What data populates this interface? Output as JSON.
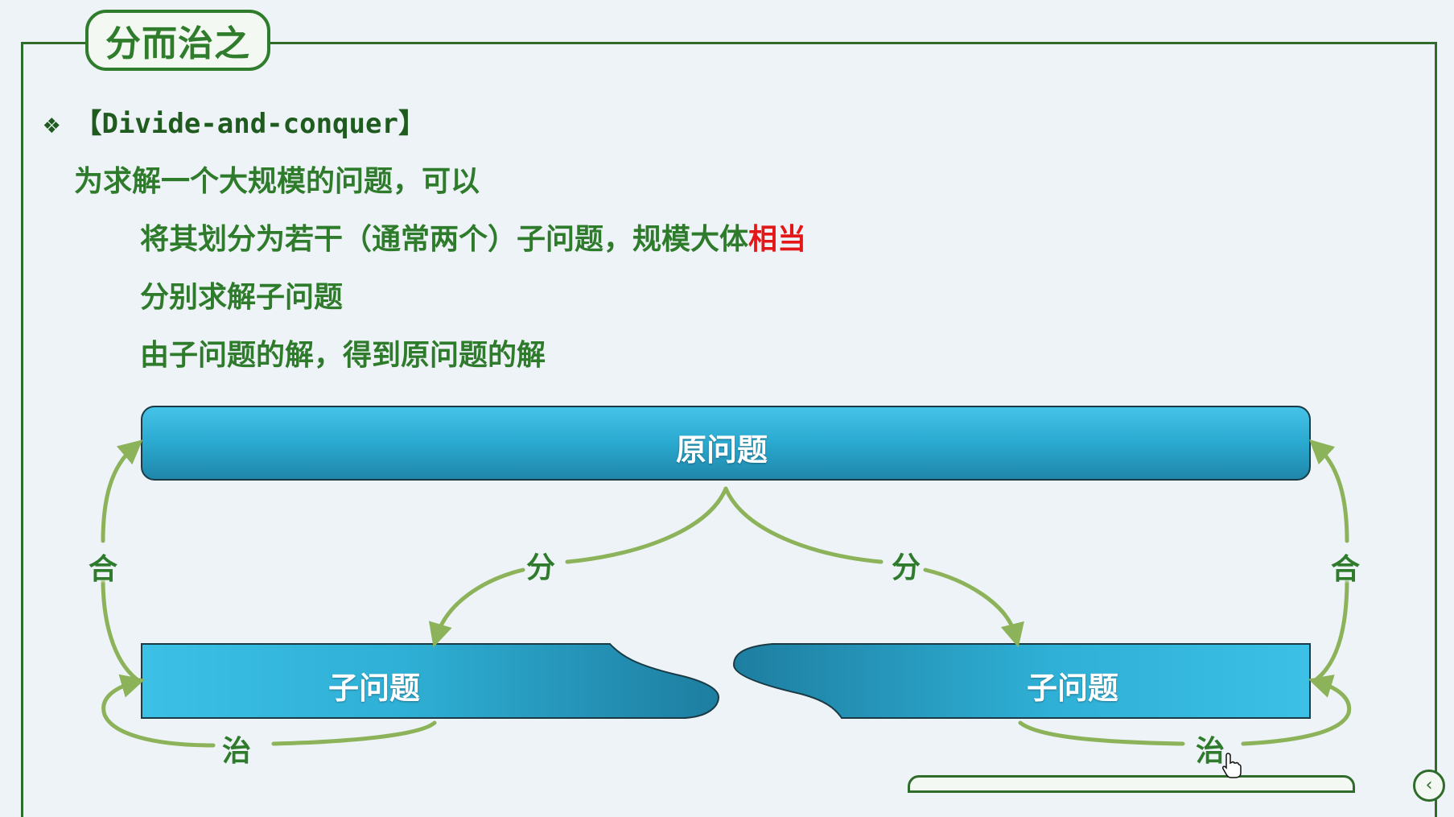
{
  "title": "分而治之",
  "bullet": {
    "icon": "four-diamond-bullet-icon",
    "text": "【Divide-and-conquer】"
  },
  "lines": {
    "intro": "为求解一个大规模的问题，可以",
    "step1_prefix": "将其划分为若干（通常两个）子问题，规模大体",
    "step1_highlight": "相当",
    "step2": "分别求解子问题",
    "step3": "由子问题的解，得到原问题的解"
  },
  "diagram": {
    "original": "原问题",
    "sub_left": "子问题",
    "sub_right": "子问题",
    "divide_left": "分",
    "divide_right": "分",
    "merge_left": "合",
    "merge_right": "合",
    "solve_left": "治",
    "solve_right": "治"
  },
  "colors": {
    "title_green": "#2f7d2c",
    "highlight_red": "#e31717",
    "box_blue": "#2aa9d0",
    "arrow_green": "#8db35a"
  },
  "nav": {
    "back_icon": "chevron-left-icon"
  },
  "cursor_icon": "hand-pointer-icon"
}
